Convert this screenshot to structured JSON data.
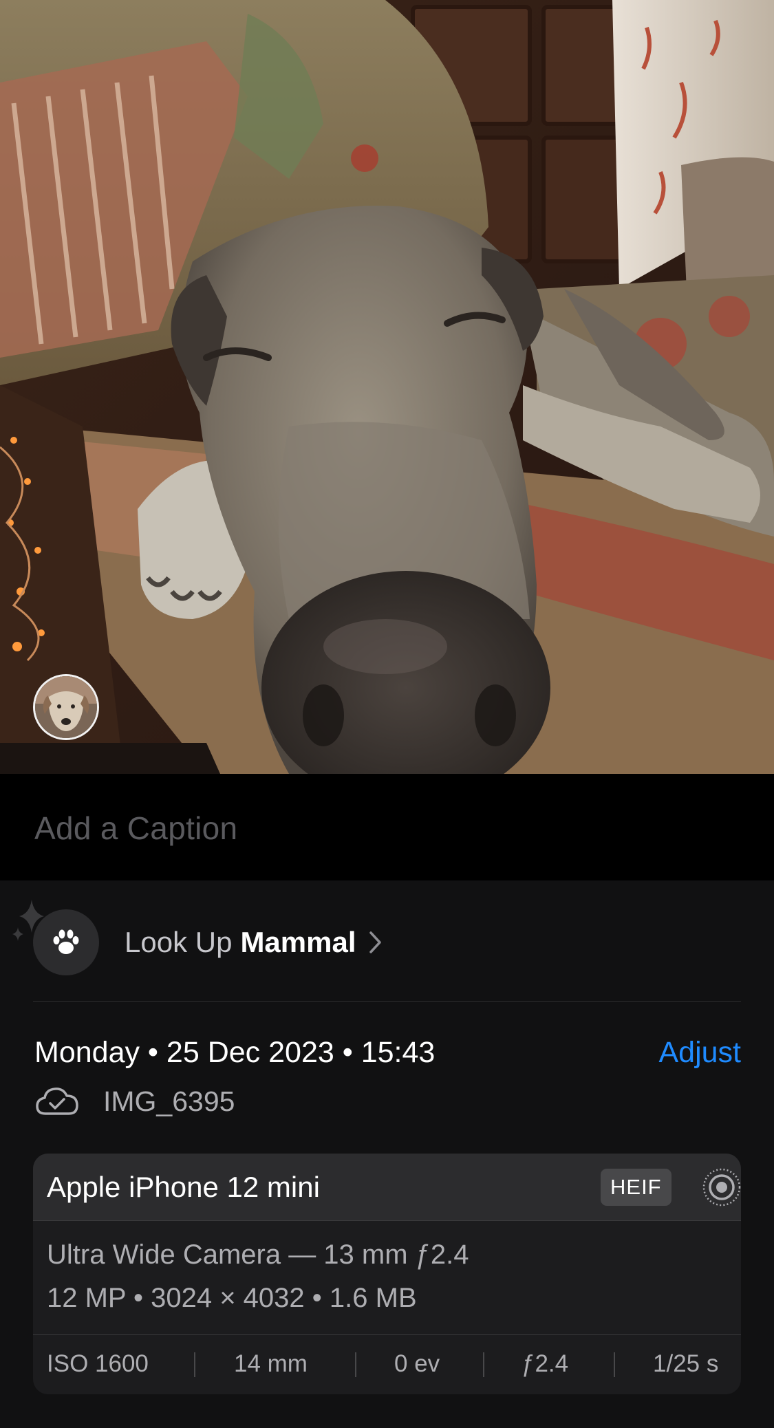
{
  "caption": {
    "placeholder": "Add a Caption"
  },
  "lookup": {
    "prefix": "Look Up",
    "subject": "Mammal",
    "icon": "paw-icon"
  },
  "info": {
    "datetime": "Monday • 25 Dec 2023 • 15:43",
    "adjust_label": "Adjust",
    "filename": "IMG_6395",
    "cloud_icon": "icloud-synced-icon"
  },
  "camera": {
    "device": "Apple iPhone 12 mini",
    "format_badge": "HEIF",
    "lens": "Ultra Wide Camera — 13 mm ƒ2.4",
    "specs": "12 MP  •  3024 × 4032  •  1.6 MB",
    "exif": {
      "iso": "ISO 1600",
      "focal": "14 mm",
      "exposure": "0 ev",
      "aperture": "ƒ2.4",
      "shutter": "1/25 s"
    }
  },
  "colors": {
    "accent": "#1f8bff",
    "panel_bg": "#111112",
    "card_bg": "#1c1c1e",
    "card_header_bg": "#2c2c2e"
  }
}
